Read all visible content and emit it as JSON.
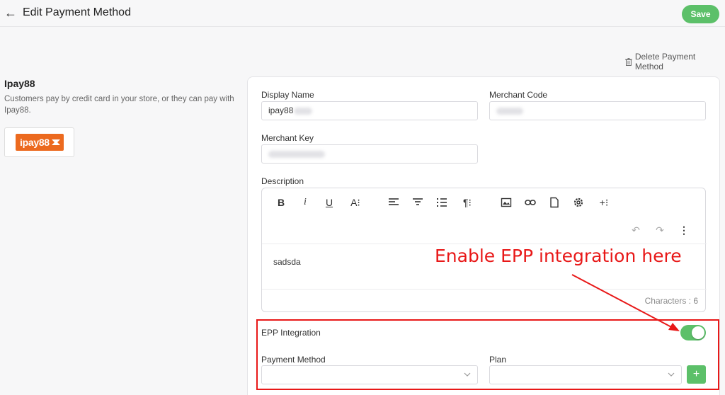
{
  "header": {
    "title": "Edit Payment Method",
    "back_icon": "arrow-left-icon",
    "save_label": "Save"
  },
  "delete_label": "Delete Payment Method",
  "provider": {
    "name": "Ipay88",
    "description": "Customers pay by credit card in your store, or they can pay with Ipay88.",
    "logo_text": "ipay88"
  },
  "form": {
    "display_name_label": "Display Name",
    "display_name_value": "ipay88",
    "merchant_code_label": "Merchant Code",
    "merchant_key_label": "Merchant Key",
    "description_label": "Description",
    "description_content": "sadsda",
    "characters_label": "Characters : 6",
    "epp_label": "EPP Integration",
    "epp_enabled": true,
    "payment_method_label": "Payment Method",
    "plan_label": "Plan",
    "add_label": "+"
  },
  "toolbar": {
    "bold": "B",
    "italic": "i",
    "underline": "U",
    "font_size": "A⁝",
    "paragraph": "¶⁝",
    "more_insert": "+⁝"
  },
  "annotation": {
    "text": "Enable EPP integration here",
    "color": "#e81818"
  },
  "colors": {
    "accent": "#5cc069",
    "annotation": "#e81818"
  }
}
